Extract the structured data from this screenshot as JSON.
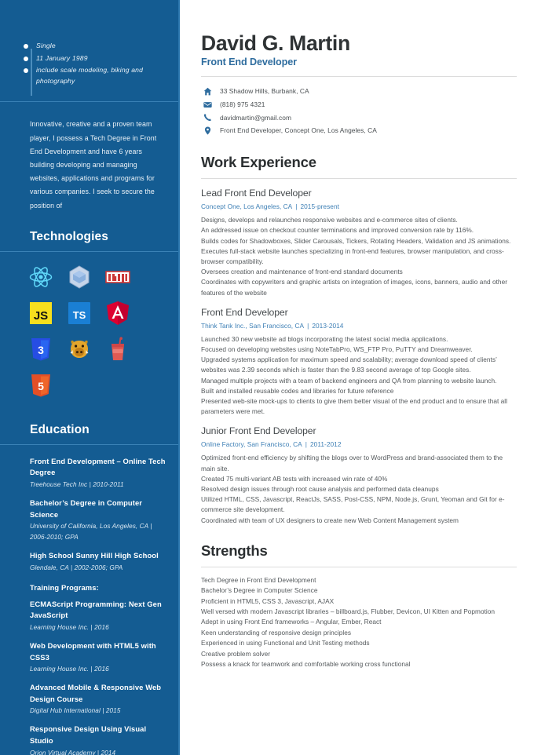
{
  "colors": {
    "sidebar_bg": "#145c92",
    "accent_blue": "#2e6c9e",
    "link_blue": "#3d7fb5",
    "heading_dark": "#2b2f31",
    "body_gray": "#54595c"
  },
  "sidebar": {
    "facts": [
      "Single",
      "11 January 1989",
      "include scale modeling, biking and photography"
    ],
    "profile": "Innovative, creative and a proven team player, I possess a Tech Degree in Front End Development and have 6 years building developing and managing websites, applications and programs for various companies. I seek to secure the position of",
    "technologies_heading": "Technologies",
    "technologies": [
      {
        "name": "react-icon",
        "label": "React"
      },
      {
        "name": "webpack-icon",
        "label": "Webpack"
      },
      {
        "name": "npm-icon",
        "label": "npm"
      },
      {
        "name": "javascript-icon",
        "label": "JS"
      },
      {
        "name": "typescript-icon",
        "label": "TS"
      },
      {
        "name": "angular-icon",
        "label": "Angular"
      },
      {
        "name": "css3-icon",
        "label": "CSS3"
      },
      {
        "name": "pug-icon",
        "label": "Pug"
      },
      {
        "name": "gulp-icon",
        "label": "Gulp"
      },
      {
        "name": "html5-icon",
        "label": "HTML5"
      }
    ],
    "education_heading": "Education",
    "education": [
      {
        "title": "Front End Development – Online Tech Degree",
        "sub": "Treehouse Tech Inc   |   2010-2011"
      },
      {
        "title": "Bachelor’s Degree in Computer Science",
        "sub": "University of California, Los Angeles, CA   |   2006-2010; GPA"
      },
      {
        "title": "High School Sunny Hill High School",
        "sub": "Glendale, CA   |   2002-2006; GPA"
      }
    ],
    "training_heading": "Training Programs:",
    "training": [
      {
        "title": "ECMAScript Programming: Next Gen JavaScript",
        "sub": "Learning House Inc.  |   2016"
      },
      {
        "title": "Web Development with HTML5 with CSS3",
        "sub": "Learning House Inc.  |   2016"
      },
      {
        "title": "Advanced Mobile & Responsive Web Design Course",
        "sub": "Digital Hub International  |   2015"
      },
      {
        "title": "Responsive Design Using Visual Studio",
        "sub": "Orion Virtual Academy  |   2014"
      }
    ]
  },
  "header": {
    "name": "David G. Martin",
    "role": "Front End Developer",
    "contacts": [
      {
        "icon": "home-icon",
        "text": "33 Shadow Hills, Burbank, CA"
      },
      {
        "icon": "envelope-icon",
        "text": "(818) 975 4321"
      },
      {
        "icon": "phone-icon",
        "text": "davidmartin@gmail.com"
      },
      {
        "icon": "location-pin-icon",
        "text": "Front End Developer, Concept One, Los Angeles, CA"
      }
    ]
  },
  "work": {
    "heading": "Work Experience",
    "jobs": [
      {
        "title": "Lead Front End Developer",
        "company": "Concept One, Los Angeles, CA",
        "dates": "2015-present",
        "bullets": [
          "Designs, develops and relaunches responsive websites and e-commerce sites of clients.",
          "An addressed issue on checkout counter terminations and improved conversion rate by 116%.",
          "Builds codes for Shadowboxes, Slider Carousals, Tickers, Rotating Headers, Validation and JS animations.",
          "Executes full-stack website launches specializing in front-end features, browser manipulation, and cross-browser compatibility.",
          "Oversees creation and maintenance of front-end standard documents",
          "Coordinates with copywriters and graphic artists on integration of images, icons, banners, audio and other features of the website"
        ]
      },
      {
        "title": "Front End Developer",
        "company": "Think Tank Inc., San Francisco, CA",
        "dates": "2013-2014",
        "bullets": [
          "Launched 30 new website ad blogs incorporating the latest social media applications.",
          "Focused on developing websites using NoteTabPro, WS_FTP Pro, PuTTY and Dreamweaver.",
          "Upgraded systems application for maximum speed and scalability; average download speed of clients’ websites was 2.39 seconds which is faster than the 9.83 second average of top Google sites.",
          "Managed multiple projects with a team of backend engineers and QA from planning to website launch.",
          "Built and installed reusable codes and libraries for future reference",
          "Presented web-site mock-ups to clients to give them better visual of the end product and to ensure that all parameters were met."
        ]
      },
      {
        "title": "Junior Front End Developer",
        "company": "Online Factory, San Francisco, CA",
        "dates": "2011-2012",
        "bullets": [
          "Optimized front-end efficiency by shifting the blogs over to WordPress and brand-associated them to the main site.",
          "Created 75 multi-variant AB tests with increased win rate of 40%",
          "Resolved design issues through root cause analysis and performed data cleanups",
          "Utilized HTML, CSS, Javascript, ReactJs, SASS, Post-CSS, NPM, Node.js, Grunt, Yeoman and Git for e-commerce site development.",
          "Coordinated with team of UX designers to create new Web Content Management system"
        ]
      }
    ]
  },
  "strengths": {
    "heading": "Strengths",
    "items": [
      "Tech Degree in Front End Development",
      "Bachelor’s Degree in Computer Science",
      "Proficient in HTML5, CSS 3, Javascript, AJAX",
      "Well versed with modern Javascript libraries – billboard.js, Flubber, Devicon, UI Kitten and Popmotion",
      "Adept in using Front End frameworks – Angular, Ember, React",
      "Keen understanding of responsive design principles",
      "Experienced in using Functional and Unit Testing methods",
      "Creative problem solver",
      "Possess a knack for teamwork and comfortable working cross functional"
    ]
  }
}
